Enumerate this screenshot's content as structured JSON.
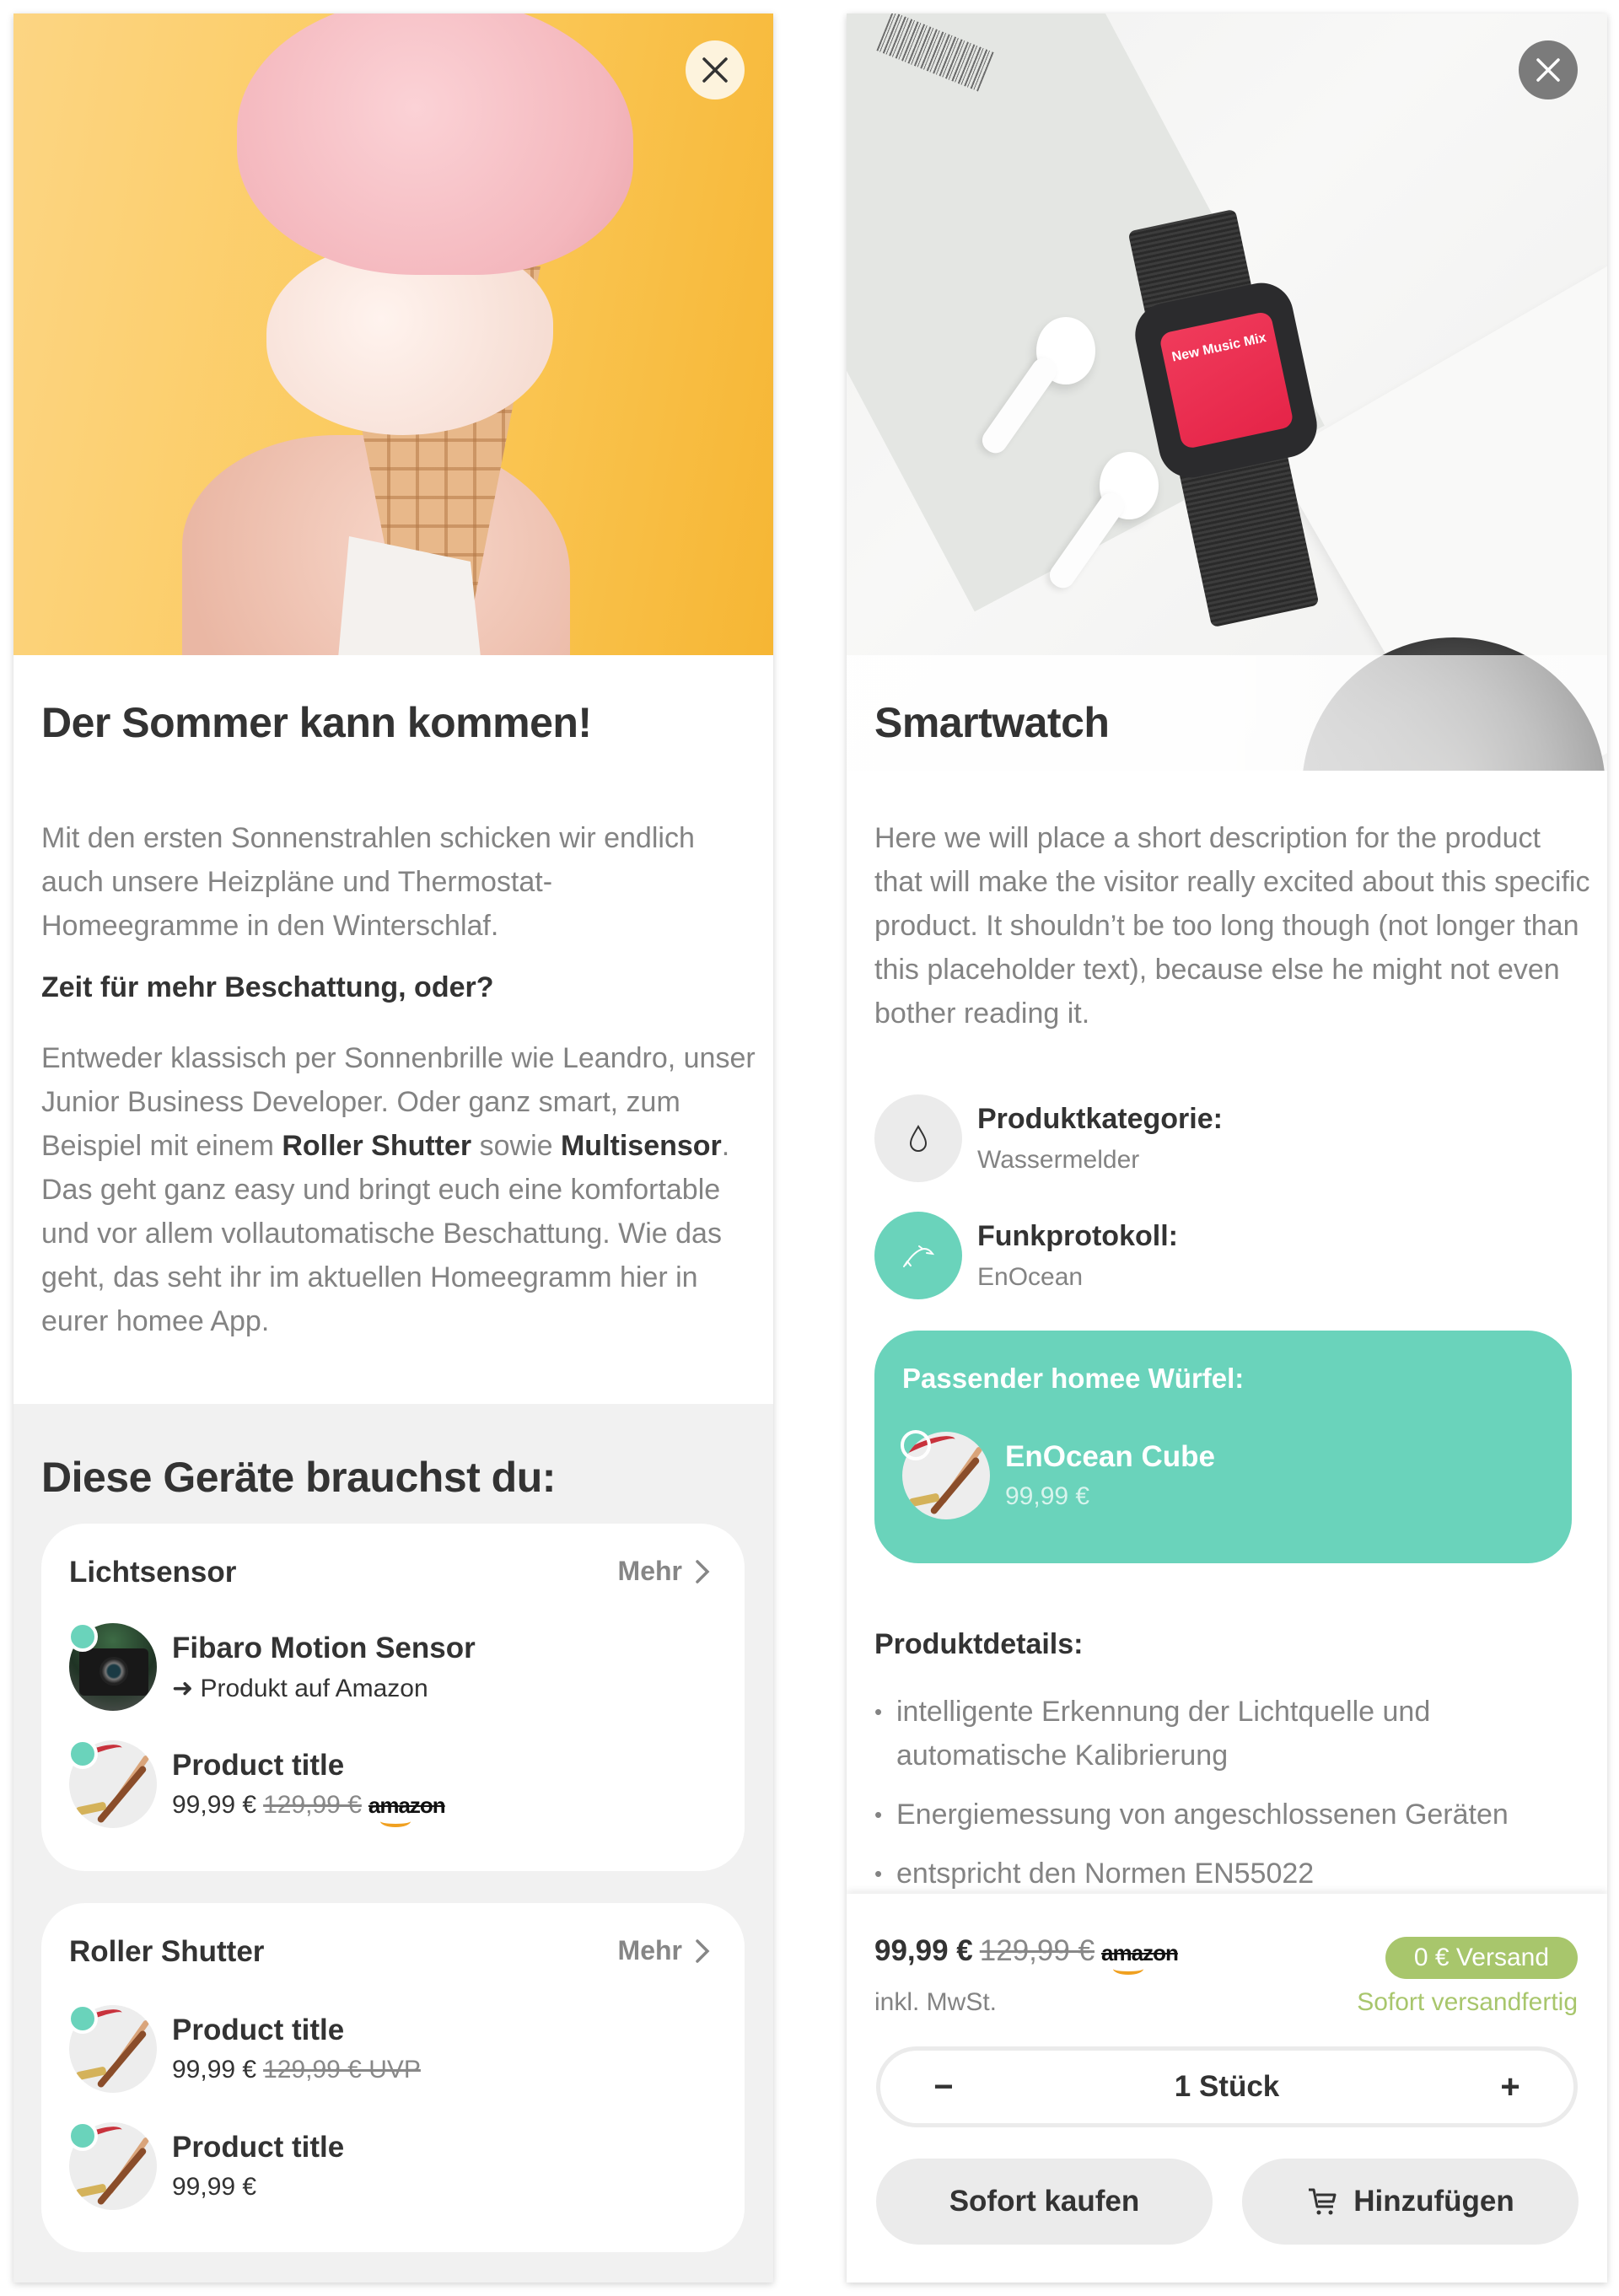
{
  "colors": {
    "accent_teal": "#6ad3bb",
    "ship_green": "#a8c66c",
    "text_dark": "#333333",
    "text_gray": "#838383"
  },
  "left_card": {
    "close_icon": "close-icon",
    "title": "Der Sommer kann kommen!",
    "intro": "Mit den ersten Sonnenstrahlen schicken wir endlich auch unsere Heizpläne und Thermostat-Homeegramme in den Winterschlaf.",
    "subheading": "Zeit für mehr Beschattung, oder?",
    "para_part1": "Entweder klassisch per Sonnenbrille wie Leandro, unser Junior Business Developer. Oder ganz smart, zum Beispiel mit einem ",
    "para_bold1": "Roller Shutter",
    "para_part2": " sowie ",
    "para_bold2": "Multisensor",
    "para_part3": ". Das geht ganz easy und bringt euch eine komfortable und vor allem vollautomatische Beschattung. Wie das geht, das seht ihr im aktuellen Homeegramm hier in eurer homee App.",
    "devices_heading": "Diese Geräte brauchst du:",
    "groups": [
      {
        "name": "Lichtsensor",
        "more_label": "Mehr",
        "items": [
          {
            "title": "Fibaro Motion Sensor",
            "link": "➜ Produkt auf Amazon",
            "image": "camera"
          },
          {
            "title": "Product title",
            "price": "99,99 €",
            "old_price": "129,99 €",
            "source": "amazon",
            "image": "pens"
          }
        ]
      },
      {
        "name": "Roller Shutter",
        "more_label": "Mehr",
        "items": [
          {
            "title": "Product title",
            "price": "99,99 €",
            "old_price": "129,99 € UVP",
            "image": "pens"
          },
          {
            "title": "Product title",
            "price": "99,99 €",
            "image": "pens"
          }
        ]
      }
    ]
  },
  "right_card": {
    "close_icon": "close-icon",
    "title": "Smartwatch",
    "watch_screen_text": "New Music Mix",
    "description": "Here we will place a short description for the product that will make the visitor really excited about this specific product. It shouldn’t be too long though (not longer than this placeholder text), because else he might not even bother reading it.",
    "attributes": [
      {
        "label": "Produktkategorie:",
        "value": "Wassermelder",
        "icon": "water-drop-icon"
      },
      {
        "label": "Funkprotokoll:",
        "value": "EnOcean",
        "icon": "dolphin-icon"
      }
    ],
    "cube": {
      "title": "Passender homee Würfel:",
      "name": "EnOcean Cube",
      "price": "99,99 €"
    },
    "details_heading": "Produktdetails:",
    "details": [
      "intelligente Erkennung der Lichtquelle und automatische Kalibrierung",
      "Energiemessung von angeschlossenen Geräten",
      "entspricht den Normen EN55022"
    ],
    "buy": {
      "price": "99,99 €",
      "old_price": "129,99 €",
      "source": "amazon",
      "vat_note": "inkl. MwSt.",
      "shipping_badge": "0 € Versand",
      "availability": "Sofort versandfertig",
      "quantity_label": "1 Stück",
      "quantity": 1,
      "minus": "−",
      "plus": "+",
      "buy_now_label": "Sofort kaufen",
      "add_label": "Hinzufügen"
    }
  }
}
